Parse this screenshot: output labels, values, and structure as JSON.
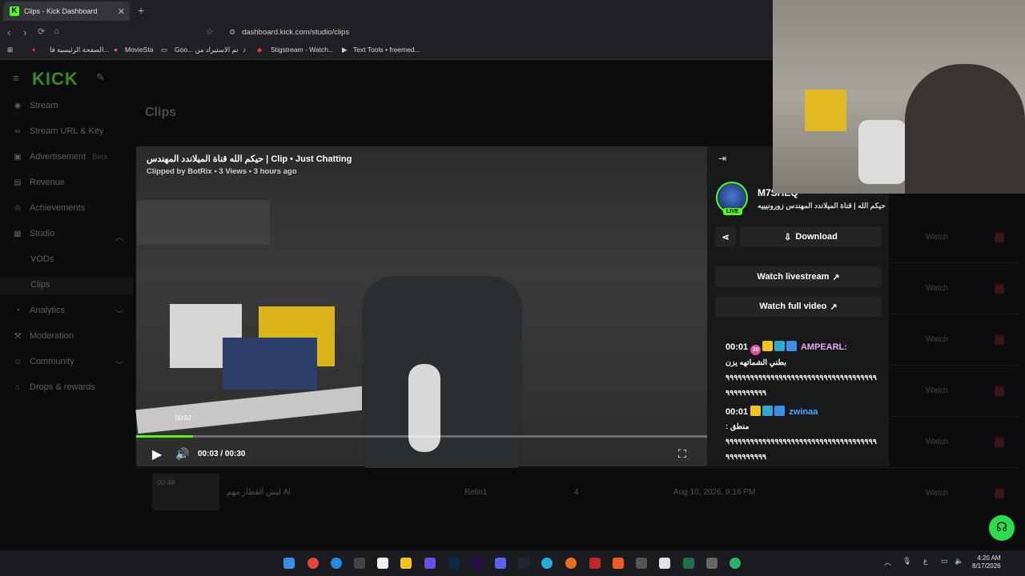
{
  "browser": {
    "tab_title": "Clips - Kick Dashboard",
    "tab_close": "✕",
    "new_tab": "+",
    "url": "dashboard.kick.com/studio/clips",
    "bookmarks": [
      "الصفحة الرئيسية فا...",
      "MovieSta",
      "Goo... تم الاستيراد من",
      "Stigstream - Watch...",
      "Text Tools • freemed..."
    ]
  },
  "sidebar": {
    "logo": "KICK",
    "items": [
      {
        "label": "Stream",
        "icon": "broadcast-icon"
      },
      {
        "label": "Stream URL & Key",
        "icon": "link-icon"
      },
      {
        "label": "Advertisement",
        "icon": "ad-icon",
        "badge": "Beta"
      },
      {
        "label": "Revenue",
        "icon": "revenue-icon"
      },
      {
        "label": "Achievements",
        "icon": "trophy-icon"
      },
      {
        "label": "Studio",
        "icon": "studio-icon"
      },
      {
        "label": "Analytics",
        "icon": "analytics-icon"
      },
      {
        "label": "Moderation",
        "icon": "hammer-icon"
      },
      {
        "label": "Community",
        "icon": "community-icon"
      },
      {
        "label": "Drops & rewards",
        "icon": "gift-icon"
      }
    ],
    "studio_sub": [
      "VODs",
      "Clips"
    ]
  },
  "page": {
    "title": "Clips"
  },
  "table": {
    "watch_label": "Watch",
    "last_row": {
      "duration": "00:48",
      "title": "ليش القطار مهم Ai",
      "clipper": "Relin1",
      "views": "4",
      "date": "Aug 10, 2026, 9:16 PM"
    }
  },
  "clip": {
    "title": "حيكم الله قناة الميلاندد المهندس | Clip • Just Chatting",
    "meta": "Clipped by BotRix • 3 Views • 3 hours ago",
    "hover_time": "00:02",
    "time_display": "00:03 / 00:30",
    "progress": 0.1
  },
  "panel": {
    "channel_name": "M7SHEQ",
    "live_label": "LIVE",
    "stream_title": "حيكم الله | قناة الميلاندد المهندس زورونيييه",
    "download_label": "Download",
    "watch_livestream": "Watch livestream",
    "watch_full_video": "Watch full video",
    "chat": [
      {
        "time": "00:01",
        "user": "AMPEARL:",
        "user_color": "#e9a7ff",
        "sub_months": "20",
        "message": "بطني الشماتهه يزن\n ٩٩٩٩٩٩٩٩٩٩٩٩٩٩٩٩٩٩٩٩٩٩٩٩٩٩٩٩٩٩٩٩٩٩٩٩٩٩٩٩٩٩٩٩٩٩٩"
      },
      {
        "time": "00:01",
        "user": "zwinaa",
        "user_color": "#47a8ff",
        "message": ": منطق\n ٩٩٩٩٩٩٩٩٩٩٩٩٩٩٩٩٩٩٩٩٩٩٩٩٩٩٩٩٩٩٩٩٩٩٩٩٩٩٩٩٩٩٩٩٩٩٩"
      }
    ]
  },
  "taskbar": {
    "clock_time": "4:20 AM",
    "clock_date": "8/17/2026",
    "lang": "ع"
  },
  "colors": {
    "brand": "#53fc18",
    "danger": "#3b1414"
  }
}
